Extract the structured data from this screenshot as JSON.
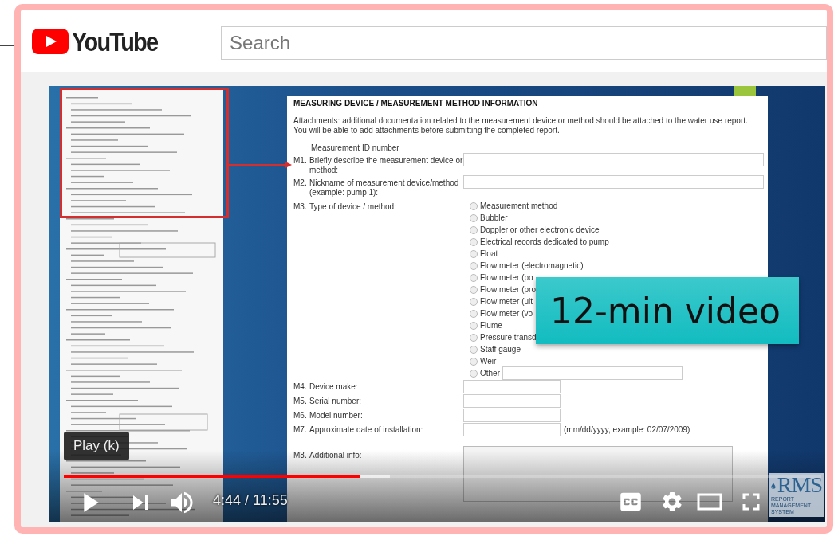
{
  "header": {
    "logo": "YouTube",
    "search": {
      "placeholder": "Search"
    }
  },
  "video": {
    "document": {
      "title": "MEASURING DEVICE / MEASUREMENT METHOD INFORMATION",
      "note": "Attachments: additional documentation related to the measurement device or method should be attached to the water use report. You will be able to add attachments before submitting the completed report.",
      "id_label": "Measurement ID number",
      "fields": [
        {
          "number": "M1.",
          "label": "Briefly describe the measurement device or method:",
          "kind": "wide"
        },
        {
          "number": "M2.",
          "label": "Nickname of measurement device/method (example: pump 1):",
          "kind": "wide"
        },
        {
          "number": "M3.",
          "label": "Type of device / method:",
          "kind": "radio_group",
          "options": [
            {
              "label": "Measurement method",
              "selected": false
            },
            {
              "label": "Bubbler",
              "selected": false
            },
            {
              "label": "Doppler or other electronic device",
              "selected": false
            },
            {
              "label": "Electrical records dedicated to pump",
              "selected": false
            },
            {
              "label": "Float",
              "selected": false
            },
            {
              "label": "Flow meter (electromagnetic)",
              "selected": false
            },
            {
              "label": "Flow meter (po",
              "selected": false
            },
            {
              "label": "Flow meter (pro",
              "selected": false
            },
            {
              "label": "Flow meter (ult",
              "selected": false
            },
            {
              "label": "Flow meter (vo",
              "selected": false
            },
            {
              "label": "Flume",
              "selected": false
            },
            {
              "label": "Pressure transd",
              "selected": false
            },
            {
              "label": "Staff gauge",
              "selected": false
            },
            {
              "label": "Weir",
              "selected": false
            },
            {
              "label": "Other",
              "selected": false,
              "with_input": true
            }
          ]
        },
        {
          "number": "M4.",
          "label": "Device make:",
          "kind": "short"
        },
        {
          "number": "M5.",
          "label": "Serial number:",
          "kind": "short"
        },
        {
          "number": "M6.",
          "label": "Model number:",
          "kind": "short"
        },
        {
          "number": "M7.",
          "label": "Approximate date of installation:",
          "kind": "short",
          "hint": "(mm/dd/yyyy, example: 02/07/2009)"
        },
        {
          "number": "M8.",
          "label": "Additional info:",
          "kind": "area"
        }
      ]
    },
    "badge": "12-min video",
    "logo": {
      "name": "RMS",
      "tagline": "REPORT MANAGEMENT SYSTEM"
    },
    "player": {
      "tooltip": "Play (k)",
      "time": "4:44 / 11:55",
      "progress": {
        "level": 0.39
      },
      "buffer": {
        "level": 0.43
      }
    }
  }
}
